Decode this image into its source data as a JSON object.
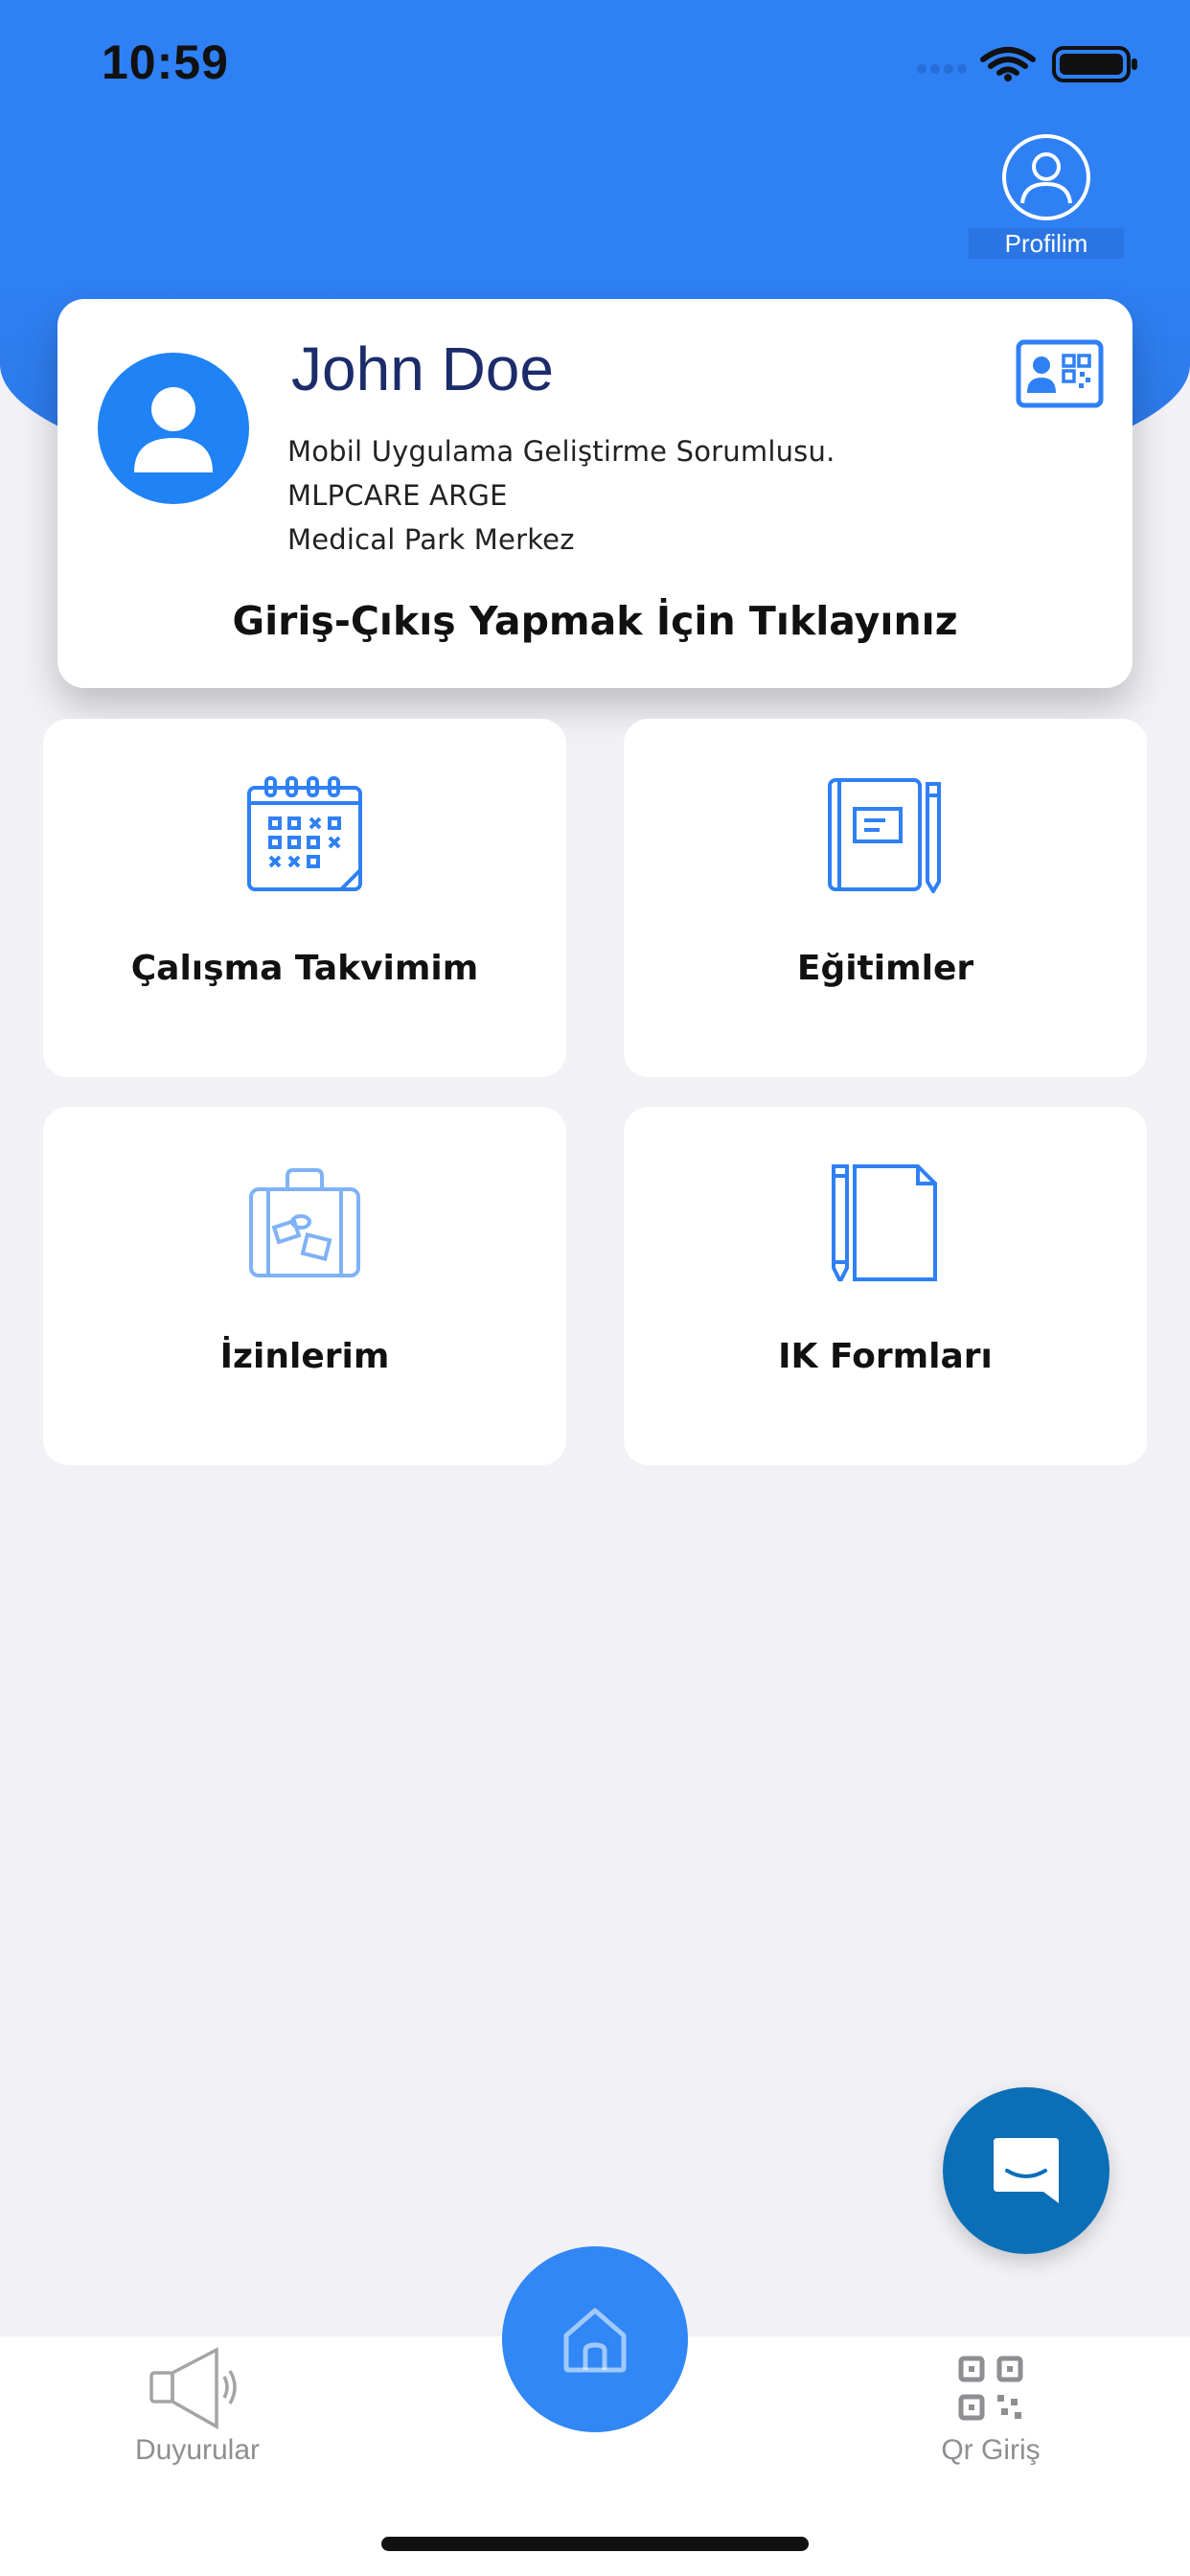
{
  "status_bar": {
    "time": "10:59"
  },
  "header": {
    "profile_label": "Profilim"
  },
  "employee_card": {
    "name": "John Doe",
    "title": "Mobil Uygulama Geliştirme Sorumlusu.",
    "department": "MLPCARE ARGE",
    "location": "Medical Park Merkez",
    "cta": "Giriş-Çıkış Yapmak İçin Tıklayınız"
  },
  "menu": [
    {
      "label": "Çalışma Takvimim",
      "icon": "calendar-icon"
    },
    {
      "label": "Eğitimler",
      "icon": "notebook-pencil-icon"
    },
    {
      "label": "İzinlerim",
      "icon": "suitcase-icon"
    },
    {
      "label": "IK Formları",
      "icon": "document-pencil-icon"
    }
  ],
  "tabbar": {
    "left_label": "Duyurular",
    "left_icon": "megaphone-icon",
    "center_icon": "home-icon",
    "right_label": "Qr Giriş",
    "right_icon": "qr-code-icon"
  },
  "colors": {
    "header_blue": "#2f80f5",
    "card_avatar_blue": "#1f82f5",
    "icon_blue": "#2f80f5",
    "chat_blue": "#0a6fb6",
    "background": "#f1f1f6",
    "tab_gray": "#8e8e93"
  }
}
